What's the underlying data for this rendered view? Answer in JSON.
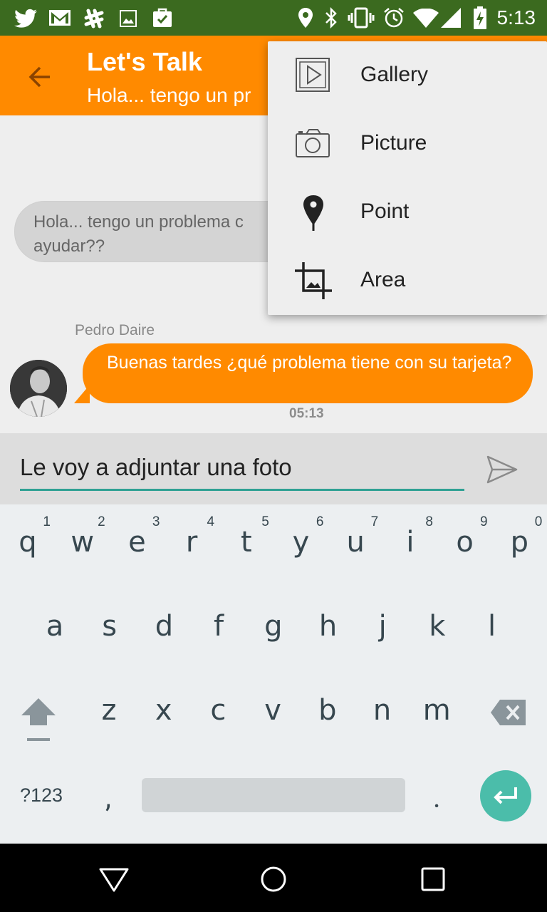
{
  "status_bar": {
    "time": "5:13",
    "left_icons": [
      "twitter-icon",
      "gmail-icon",
      "slack-icon",
      "image-icon",
      "briefcase-check-icon"
    ],
    "right_icons": [
      "location-icon",
      "bluetooth-icon",
      "vibrate-icon",
      "alarm-icon",
      "wifi-icon",
      "signal-icon",
      "battery-charging-icon"
    ],
    "color": "#3b6a1f"
  },
  "app_bar": {
    "title": "Let's Talk",
    "subtitle": "Hola... tengo un pr",
    "color": "#ff8a00"
  },
  "chat": {
    "incoming": {
      "line1": "Hola... tengo un problema c",
      "line2": "ayudar??"
    },
    "outgoing": {
      "sender": "Pedro Daire",
      "text": "Buenas tardes ¿qué problema tiene con su tarjeta?",
      "time": "05:13"
    }
  },
  "input": {
    "value": "Le voy a adjuntar una foto",
    "accent": "#2fa193"
  },
  "menu": {
    "items": [
      {
        "label": "Gallery",
        "icon": "gallery-icon"
      },
      {
        "label": "Picture",
        "icon": "camera-icon"
      },
      {
        "label": "Point",
        "icon": "map-pin-icon"
      },
      {
        "label": "Area",
        "icon": "crop-icon"
      }
    ]
  },
  "keyboard": {
    "row1": [
      {
        "c": "q",
        "n": "1"
      },
      {
        "c": "w",
        "n": "2"
      },
      {
        "c": "e",
        "n": "3"
      },
      {
        "c": "r",
        "n": "4"
      },
      {
        "c": "t",
        "n": "5"
      },
      {
        "c": "y",
        "n": "6"
      },
      {
        "c": "u",
        "n": "7"
      },
      {
        "c": "i",
        "n": "8"
      },
      {
        "c": "o",
        "n": "9"
      },
      {
        "c": "p",
        "n": "0"
      }
    ],
    "row2": [
      "a",
      "s",
      "d",
      "f",
      "g",
      "h",
      "j",
      "k",
      "l"
    ],
    "row3": [
      "z",
      "x",
      "c",
      "v",
      "b",
      "n",
      "m"
    ],
    "symbols_label": "?123",
    "comma": ",",
    "period": ".",
    "enter_color": "#4bbdaa"
  }
}
